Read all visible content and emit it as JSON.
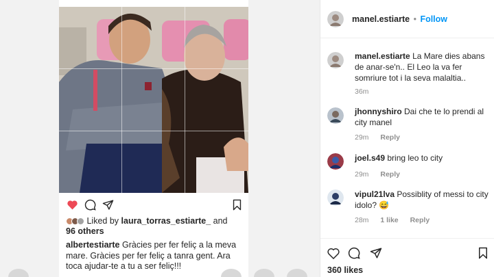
{
  "post": {
    "likes_prefix": "Liked by",
    "liked_by_user": "laura_torras_estiarte_",
    "likes_and": "and",
    "likes_count": "96 others",
    "caption_user": "albertestiarte",
    "caption_text": "Gràcies per fer feliç a la meva mare. Gràcies per fer feliç a tanra gent. Ara toca ajudar-te a tu a ser feliç!!!"
  },
  "panel": {
    "header_user": "manel.estiarte",
    "follow_label": "Follow",
    "likes": "360 likes",
    "comments": [
      {
        "user": "manel.estiarte",
        "text": "La Mare dies abans de anar-se'n.. El Leo la va fer somriure tot i la seva malaltia..",
        "time": "36m",
        "likes": "",
        "reply": ""
      },
      {
        "user": "jhonnyshiro",
        "text": "Dai che te lo prendi al city manel",
        "time": "29m",
        "likes": "",
        "reply": "Reply"
      },
      {
        "user": "joel.s49",
        "text": "bring leo to city",
        "time": "29m",
        "likes": "",
        "reply": "Reply"
      },
      {
        "user": "vipul21lva",
        "text": "Possiblity of messi to city idolo? 😅",
        "time": "28m",
        "likes": "1 like",
        "reply": "Reply"
      }
    ]
  },
  "colors": {
    "heart": "#ed4956",
    "link": "#0095f6",
    "muted": "#8e8e8e"
  },
  "icons": [
    "heart-icon",
    "comment-icon",
    "share-icon",
    "bookmark-icon"
  ]
}
